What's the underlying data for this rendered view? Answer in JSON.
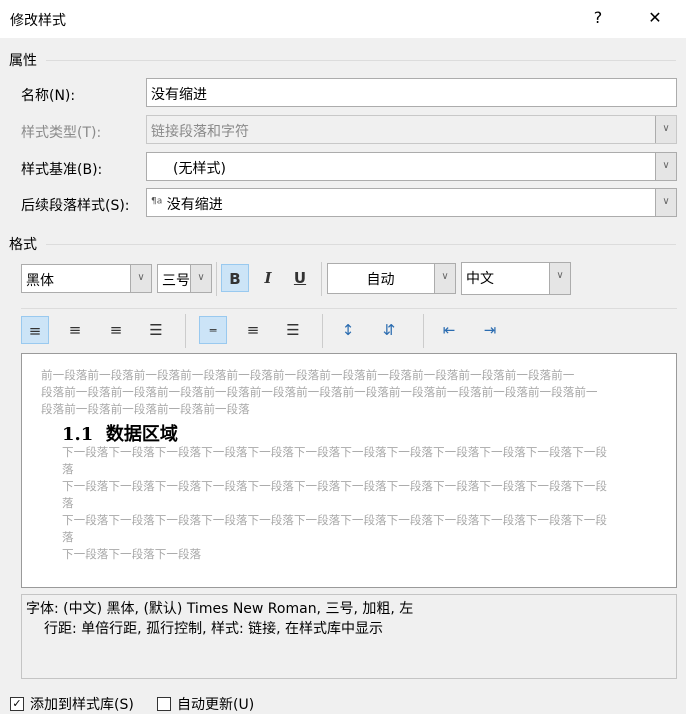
{
  "dialog": {
    "title": "修改样式",
    "help": "?",
    "close": "✕"
  },
  "properties": {
    "section": "属性",
    "name_label": "名称(N):",
    "name_value": "没有缩进",
    "type_label": "样式类型(T):",
    "type_value": "链接段落和字符",
    "based_label": "样式基准(B):",
    "based_value": "(无样式)",
    "next_label": "后续段落样式(S):",
    "next_value": "没有缩进",
    "next_icon": "¶a"
  },
  "format": {
    "section": "格式",
    "font": "黑体",
    "size": "三号",
    "bold": "B",
    "italic": "I",
    "underline": "U",
    "color": "自动",
    "script": "中文"
  },
  "preview": {
    "prev_lines": [
      "前一段落前一段落前一段落前一段落前一段落前一段落前一段落前一段落前一段落前一段落前一段落前一",
      "段落前一段落前一段落前一段落前一段落前一段落前一段落前一段落前一段落前一段落前一段落前一段落前一",
      "段落前一段落前一段落前一段落前一段落"
    ],
    "heading": "1.1  数据区域",
    "next_lines": [
      "下一段落下一段落下一段落下一段落下一段落下一段落下一段落下一段落下一段落下一段落下一段落下一段落",
      "下一段落下一段落下一段落下一段落下一段落下一段落下一段落下一段落下一段落下一段落下一段落下一段落",
      "下一段落下一段落下一段落下一段落下一段落下一段落下一段落下一段落下一段落下一段落下一段落下一段落",
      "下一段落下一段落下一段落"
    ]
  },
  "description": {
    "line1": "字体: (中文) 黑体, (默认) Times New Roman, 三号, 加粗, 左",
    "line2": "行距: 单倍行距, 孤行控制, 样式: 链接, 在样式库中显示"
  },
  "options": {
    "add_to_gallery": "添加到样式库(S)",
    "add_checked": true,
    "auto_update": "自动更新(U)",
    "auto_checked": false
  }
}
